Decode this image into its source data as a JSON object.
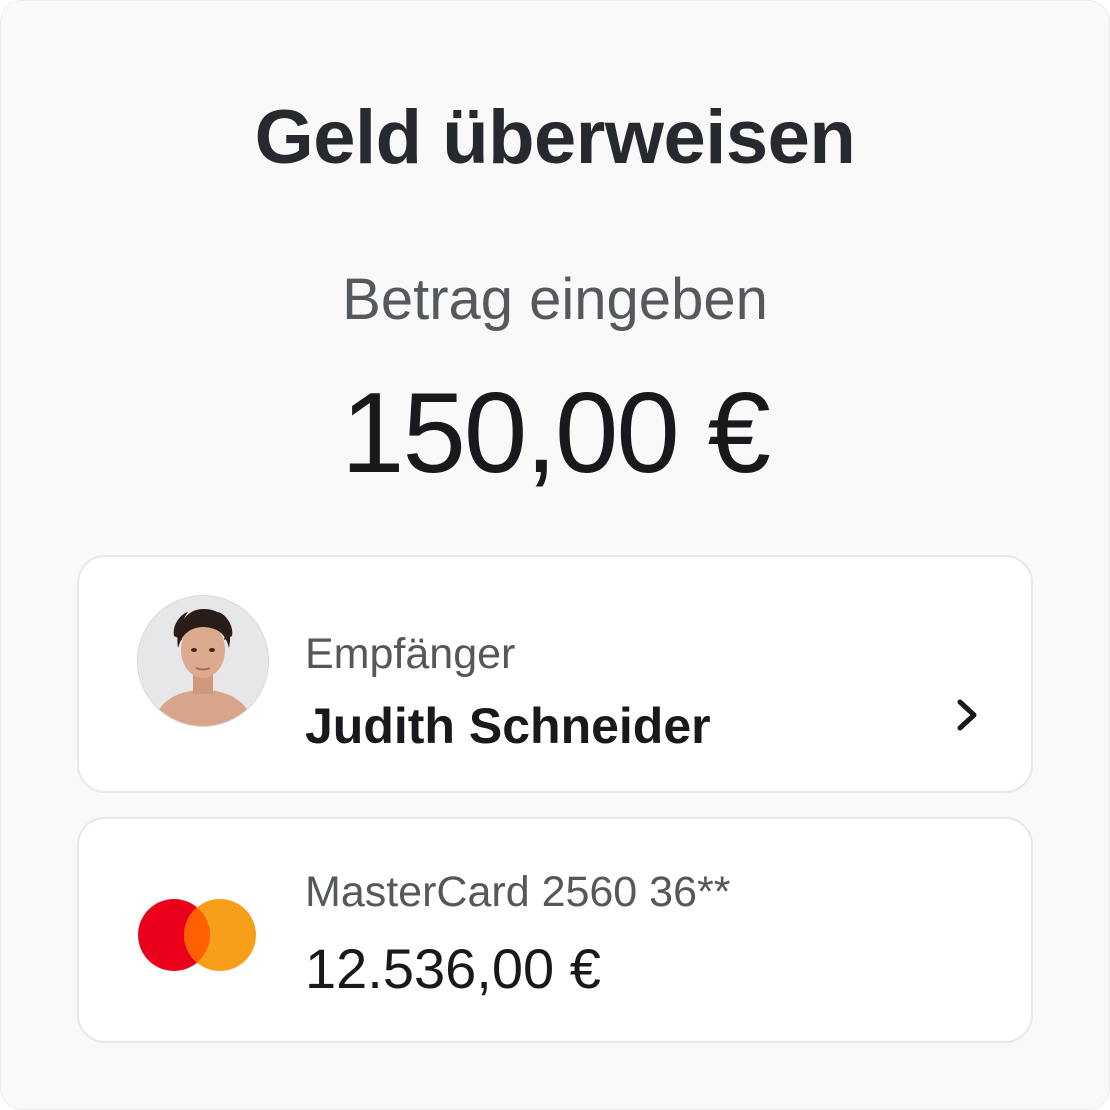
{
  "header": {
    "title": "Geld überweisen"
  },
  "amount": {
    "label": "Betrag eingeben",
    "value": "150,00 €"
  },
  "recipient": {
    "label": "Empfänger",
    "name": "Judith Schneider"
  },
  "payment": {
    "card": "MasterCard 2560 36**",
    "balance": "12.536,00 €"
  },
  "icons": {
    "chevron": "chevron-right-icon",
    "card_logo": "mastercard-icon"
  },
  "colors": {
    "mastercard_red": "#eb001b",
    "mastercard_orange": "#f79e1b",
    "mastercard_overlap": "#ff5f00"
  }
}
